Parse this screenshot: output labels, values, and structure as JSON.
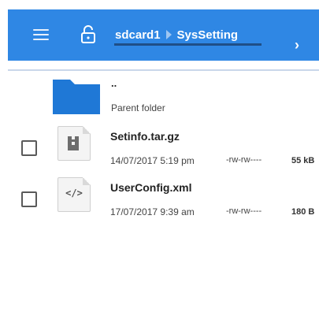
{
  "toolbar": {
    "breadcrumb": [
      "sdcard1",
      "SysSetting"
    ]
  },
  "parent": {
    "name": "..",
    "label": "Parent folder"
  },
  "files": [
    {
      "name": "Setinfo.tar.gz",
      "date": "14/07/2017 5:19 pm",
      "perm": "-rw-rw----",
      "size": "55 kB",
      "icon": "archive-icon"
    },
    {
      "name": "UserConfig.xml",
      "date": "17/07/2017 9:39 am",
      "perm": "-rw-rw----",
      "size": "180 B",
      "icon_text": "</>",
      "icon": "code-icon"
    }
  ],
  "colors": {
    "toolbar": "#2f87e4",
    "folder": "#1f78d6"
  }
}
